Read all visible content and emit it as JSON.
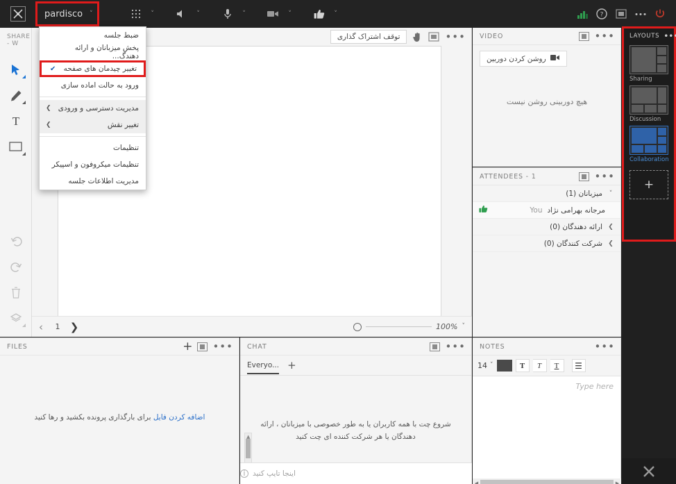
{
  "topbar": {
    "logo_icon": "app-logo-icon",
    "room_name": "pardisco",
    "chevron": "˅",
    "icons": [
      {
        "name": "apps-grid-icon",
        "glyph": "⠿"
      },
      {
        "name": "speaker-icon",
        "glyph": "🔊"
      },
      {
        "name": "microphone-icon",
        "glyph": "🎤"
      },
      {
        "name": "camera-icon",
        "glyph": "📹"
      },
      {
        "name": "thumbs-up-icon",
        "glyph": "👍"
      }
    ],
    "right_icons": [
      {
        "name": "signal-strength-icon",
        "glyph": "▁▃▅",
        "color": "#2f9e4f"
      },
      {
        "name": "help-icon",
        "glyph": "?"
      },
      {
        "name": "popout-icon",
        "glyph": "▣"
      },
      {
        "name": "more-options-icon",
        "glyph": "•••"
      },
      {
        "name": "power-icon",
        "glyph": "⏻",
        "color": "#c0392b"
      }
    ]
  },
  "menu": {
    "items": [
      {
        "label": "ضبط جلسه",
        "type": "normal"
      },
      {
        "label": "پخش میزبانان و ارائه دهندگ...",
        "type": "normal"
      },
      {
        "label": "تغییر چیدمان های صفحه",
        "type": "checked",
        "checked": true
      },
      {
        "label": "ورود به حالت اماده سازی",
        "type": "normal"
      },
      {
        "label": "",
        "type": "separator"
      },
      {
        "label": "مدیریت دسترسی و ورودی",
        "type": "submenu"
      },
      {
        "label": "تغییر نقش",
        "type": "submenu"
      },
      {
        "label": "",
        "type": "separator"
      },
      {
        "label": "تنظیمات",
        "type": "normal"
      },
      {
        "label": "تنظیمات میکروفون و اسپیکر",
        "type": "normal"
      },
      {
        "label": "مدیریت اطلاعات جلسه",
        "type": "normal"
      }
    ],
    "check_glyph": "✔",
    "submenu_glyph": "❯"
  },
  "share": {
    "title": "SHARE - W",
    "stop_share_label": "توقف اشتراک گذاری",
    "hand_icon": "hand-pointer-icon",
    "popout_icon": "popout-icon",
    "more_icon": "more-options-icon",
    "page_number": "1",
    "prev_glyph": "‹",
    "next_glyph": "❯",
    "zoom_value": "100%",
    "zoom_chevron": "˅"
  },
  "toolrail": {
    "tools": [
      {
        "name": "select-tool",
        "glyph": "➤",
        "active": true,
        "has_corner": true
      },
      {
        "name": "pencil-tool",
        "glyph": "✏",
        "active": false,
        "has_corner": true
      },
      {
        "name": "text-tool",
        "glyph": "T",
        "active": false,
        "has_corner": false
      },
      {
        "name": "shape-tool",
        "glyph": "▭",
        "active": false,
        "has_corner": true
      }
    ],
    "bottom_tools": [
      {
        "name": "undo-button",
        "glyph": "↶"
      },
      {
        "name": "redo-button",
        "glyph": "↷"
      },
      {
        "name": "delete-button",
        "glyph": "🗑"
      },
      {
        "name": "layers-button",
        "glyph": "❖"
      }
    ]
  },
  "video": {
    "title": "VIDEO",
    "camera_button_label": "روشن کردن دوربین",
    "camera_icon": "camera-icon",
    "empty_message": "هیچ دوربینی روشن نیست"
  },
  "attendees": {
    "title": "ATTENDEES  - 1",
    "groups": [
      {
        "label": "میزبانان (1)",
        "expanded": true,
        "glyph": "˅"
      },
      {
        "label": "ارائه دهندگان (0)",
        "expanded": false,
        "glyph": "❯"
      },
      {
        "label": "شرکت کنندگان (0)",
        "expanded": false,
        "glyph": "❯"
      }
    ],
    "host_name": "مرجانه بهرامی نژاد",
    "host_you_label": "You",
    "host_status_icon": "thumbs-up-icon"
  },
  "layouts": {
    "title": "LAYOUTS",
    "more_icon": "more-options-icon",
    "items": [
      {
        "label": "Sharing",
        "selected": false
      },
      {
        "label": "Discussion",
        "selected": false
      },
      {
        "label": "Collaboration",
        "selected": true
      }
    ],
    "add_glyph": "+",
    "accent_color": "#2f62a8",
    "highlight_color": "#e01b1b"
  },
  "files": {
    "title": "FILES",
    "add_glyph": "+",
    "popout_icon": "popout-icon",
    "more_icon": "more-options-icon",
    "drop_link": "اضافه کردن فایل",
    "drop_text": "برای بارگذاری پرونده بکشید و رها کنید"
  },
  "chat": {
    "title": "CHAT",
    "popout_icon": "popout-icon",
    "more_icon": "more-options-icon",
    "tab_label": "Everyo...",
    "add_tab_glyph": "+",
    "empty_message": "شروع چت با همه کاربران یا به طور خصوصی با میزبانان ، ارائه دهندگان یا هر شرکت کننده ای چت کنید",
    "input_placeholder": "اینجا تایپ کنید",
    "info_glyph": "i"
  },
  "notes": {
    "title": "NOTES",
    "more_icon": "more-options-icon",
    "font_size": "14",
    "font_size_chevron": "˅",
    "color_swatch": "#4a4a4a",
    "bold_glyph": "T",
    "italic_glyph": "T",
    "underline_glyph": "T",
    "list_glyph": "☰",
    "placeholder": "Type here"
  },
  "bottom_right": {
    "tools_icon": "crossed-tools-icon",
    "glyph": "⚒"
  }
}
